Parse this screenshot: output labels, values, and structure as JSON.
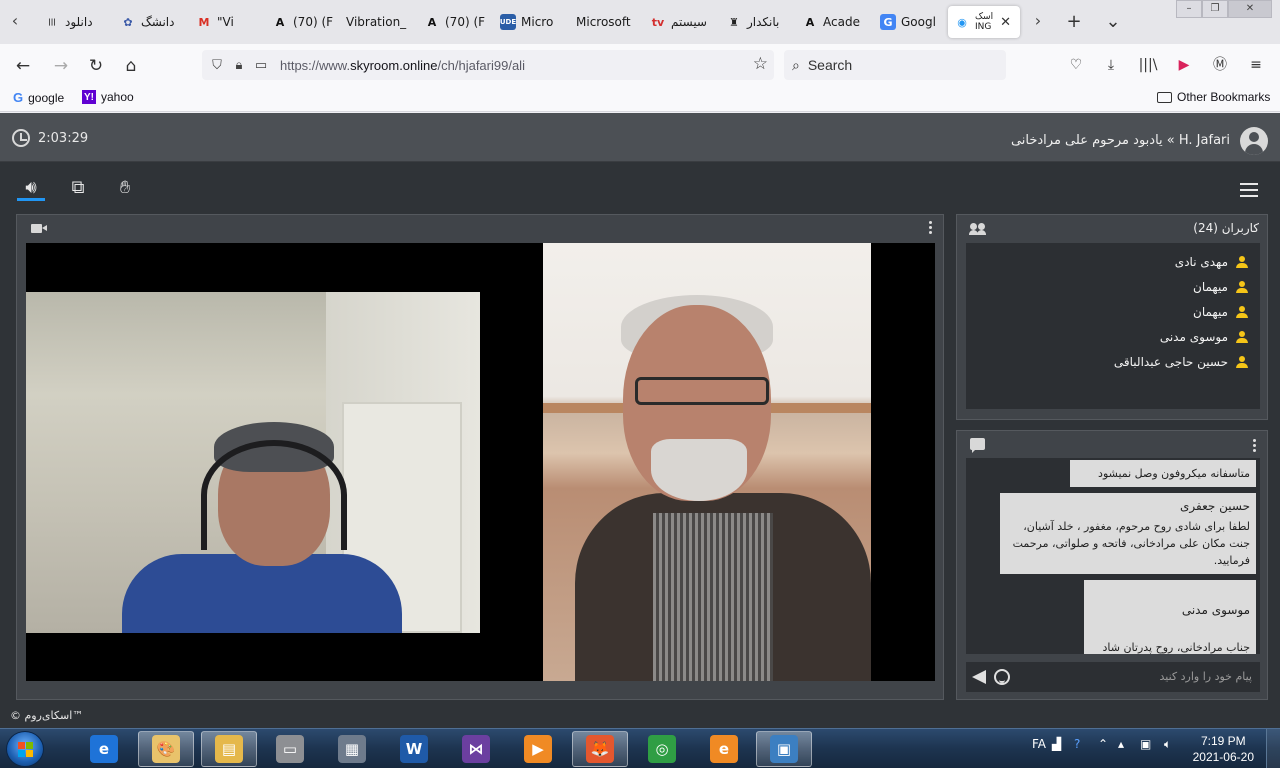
{
  "browser": {
    "tabs": [
      {
        "label": "دانلود",
        "icon": "site-icon",
        "icon_glyph": "|||",
        "icon_color": "#1a1a1a",
        "icon_bg": "transparent",
        "active": false
      },
      {
        "label": "دانشگ",
        "icon": "university-icon",
        "icon_glyph": "✿",
        "icon_color": "#3b5aa8",
        "icon_bg": "transparent",
        "active": false
      },
      {
        "label": "\"Vi",
        "icon": "gmail-icon",
        "icon_glyph": "M",
        "icon_color": "#d93025",
        "icon_bg": "transparent",
        "active": false
      },
      {
        "label": "(70) (F",
        "icon": "academia-icon",
        "icon_glyph": "A",
        "icon_color": "#111111",
        "icon_bg": "transparent",
        "active": false
      },
      {
        "label": "Vibration_",
        "icon": "",
        "icon_glyph": "",
        "icon_color": "#111111",
        "icon_bg": "transparent",
        "active": false
      },
      {
        "label": "(70) (F",
        "icon": "academia-icon",
        "icon_glyph": "A",
        "icon_color": "#111111",
        "icon_bg": "transparent",
        "active": false
      },
      {
        "label": "Micro",
        "icon": "ude-icon",
        "icon_glyph": "UDE",
        "icon_color": "#ffffff",
        "icon_bg": "#2b5ea7",
        "active": false
      },
      {
        "label": "Microsoft",
        "icon": "",
        "icon_glyph": "",
        "icon_color": "#111111",
        "icon_bg": "transparent",
        "active": false
      },
      {
        "label": "سیستم",
        "icon": "tv-icon",
        "icon_glyph": "tv",
        "icon_color": "#d32f2f",
        "icon_bg": "transparent",
        "active": false
      },
      {
        "label": "بانکدار",
        "icon": "bank-icon",
        "icon_glyph": "♜",
        "icon_color": "#222222",
        "icon_bg": "transparent",
        "active": false
      },
      {
        "label": "Acade",
        "icon": "academia-icon",
        "icon_glyph": "A",
        "icon_color": "#111111",
        "icon_bg": "transparent",
        "active": false
      },
      {
        "label": "Googl",
        "icon": "google-translate-icon",
        "icon_glyph": "G",
        "icon_color": "#ffffff",
        "icon_bg": "#4285f4",
        "active": false
      },
      {
        "label": "اسک\nING",
        "icon": "skyroom-icon",
        "icon_glyph": "◉",
        "icon_color": "#2196f3",
        "icon_bg": "transparent",
        "active": true
      }
    ],
    "active_tab_close": "✕",
    "new_tab": "+",
    "all_tabs": "⌄",
    "url": {
      "prefix": "https://www.",
      "host": "skyroom.online",
      "path": "/ch/hjafari99/ali"
    },
    "search_placeholder": "Search",
    "bookmarks": [
      {
        "label": "google"
      },
      {
        "label": "yahoo"
      }
    ],
    "other_bookmarks": "Other Bookmarks"
  },
  "app": {
    "timer": "2:03:29",
    "room_title": "H. Jafari » یادبود مرحوم علی مرادخانی",
    "users_panel_title": "کاربران (24)",
    "users": [
      "مهدی نادی",
      "میهمان",
      "میهمان",
      "موسوی مدنی",
      "حسین حاجی عبدالباقی"
    ],
    "chat_messages": [
      {
        "sender": "",
        "text": "متاسفانه میکروفون وصل نمیشود"
      },
      {
        "sender": "حسین جعفری",
        "text": "لطفا برای شادی روح مرحوم، مغفور ، خلد آشیان، جنت مکان علی مرادخانی، فاتحه و صلواتی، مرحمت فرمایید."
      },
      {
        "sender": "موسوی مدنی",
        "text": "جناب مرادخانی، روح پدرتان شاد\nلطفا any desk به بنده بدهید"
      }
    ],
    "chat_placeholder": "پیام خود را وارد کنید",
    "copyright": "© اسکای‌روم™",
    "accent": "#2196f3",
    "user_icon_color": "#f5c518"
  },
  "taskbar": {
    "apps": [
      {
        "name": "internet-explorer-icon",
        "glyph": "e",
        "bg": "#1e73d8",
        "active": false
      },
      {
        "name": "paint-icon",
        "glyph": "🎨",
        "bg": "#e9c36b",
        "active": true
      },
      {
        "name": "file-explorer-icon",
        "glyph": "▤",
        "bg": "#e5b84b",
        "active": true
      },
      {
        "name": "scanner-icon",
        "glyph": "▭",
        "bg": "#8d8f93",
        "active": false
      },
      {
        "name": "calculator-icon",
        "glyph": "▦",
        "bg": "#6e7b8c",
        "active": false
      },
      {
        "name": "word-icon",
        "glyph": "W",
        "bg": "#1f5aa8",
        "active": false
      },
      {
        "name": "visual-studio-icon",
        "glyph": "⋈",
        "bg": "#6b3fa0",
        "active": false
      },
      {
        "name": "media-player-icon",
        "glyph": "▶",
        "bg": "#f08a24",
        "active": false
      },
      {
        "name": "firefox-icon",
        "glyph": "🦊",
        "bg": "#e4572e",
        "active": true
      },
      {
        "name": "chrome-icon",
        "glyph": "◎",
        "bg": "#2f9e44",
        "active": false
      },
      {
        "name": "edge-icon",
        "glyph": "e",
        "bg": "#f08a24",
        "active": false
      },
      {
        "name": "remote-desktop-icon",
        "glyph": "▣",
        "bg": "#3c7fc1",
        "active": true
      }
    ],
    "lang": "FA",
    "time": "7:19 PM",
    "date": "2021-06-20"
  }
}
